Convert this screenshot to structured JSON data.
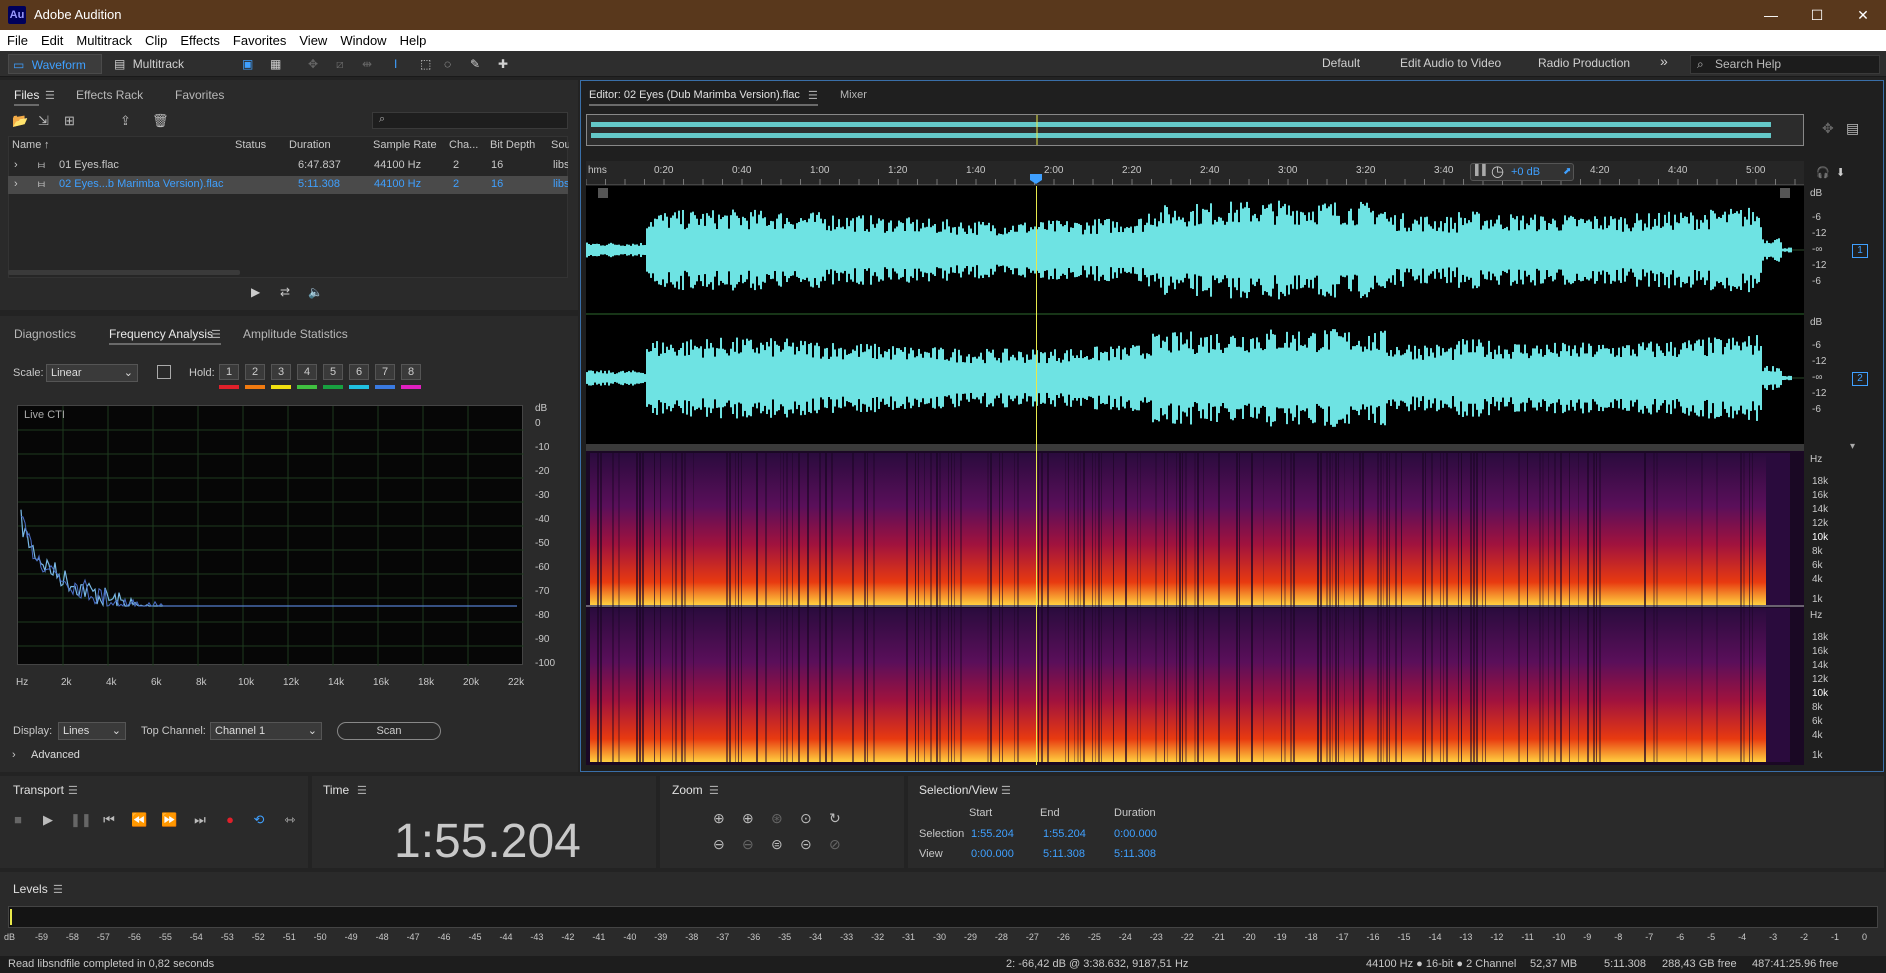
{
  "app": {
    "logo": "Au",
    "title": "Adobe Audition",
    "min": "—",
    "max": "☐",
    "close": "✕"
  },
  "menu": [
    "File",
    "Edit",
    "Multitrack",
    "Clip",
    "Effects",
    "Favorites",
    "View",
    "Window",
    "Help"
  ],
  "toolbar": {
    "waveform": "Waveform",
    "multitrack": "Multitrack",
    "workspaces": [
      "Default",
      "Edit Audio to Video",
      "Radio Production"
    ],
    "more": "»",
    "search_placeholder": "Search Help"
  },
  "files_panel": {
    "tabs": [
      "Files",
      "Effects Rack",
      "Favorites"
    ],
    "columns": [
      "Name",
      "Status",
      "Duration",
      "Sample Rate",
      "Cha...",
      "Bit Depth",
      "Sou"
    ],
    "rows": [
      {
        "name": "01 Eyes.flac",
        "status": "",
        "duration": "6:47.837",
        "rate": "44100 Hz",
        "channels": "2",
        "bits": "16",
        "source": "libs"
      },
      {
        "name": "02 Eyes...b Marimba Version).flac",
        "status": "",
        "duration": "5:11.308",
        "rate": "44100 Hz",
        "channels": "2",
        "bits": "16",
        "source": "libs"
      }
    ]
  },
  "analysis": {
    "tabs": [
      "Diagnostics",
      "Frequency Analysis",
      "Amplitude Statistics"
    ],
    "scale_label": "Scale:",
    "scale_value": "Linear",
    "hold_label": "Hold:",
    "holds": [
      "1",
      "2",
      "3",
      "4",
      "5",
      "6",
      "7",
      "8"
    ],
    "hold_colors": [
      "#e0202a",
      "#f07a10",
      "#f0e010",
      "#40c040",
      "#18a040",
      "#20c0e0",
      "#3a7ae0",
      "#e020c0"
    ],
    "graph_label": "Live CTI",
    "db_unit": "dB",
    "db_ticks": [
      "0",
      "-10",
      "-20",
      "-30",
      "-40",
      "-50",
      "-60",
      "-70",
      "-80",
      "-90",
      "-100"
    ],
    "hz_ticks": [
      "Hz",
      "2k",
      "4k",
      "6k",
      "8k",
      "10k",
      "12k",
      "14k",
      "16k",
      "18k",
      "20k",
      "22k"
    ],
    "display_label": "Display:",
    "display_value": "Lines",
    "top_channel_label": "Top Channel:",
    "top_channel_value": "Channel 1",
    "scan": "Scan",
    "advanced": "Advanced"
  },
  "editor": {
    "tab": "Editor: 02 Eyes (Dub Marimba Version).flac",
    "mixer": "Mixer",
    "ruler": [
      "hms",
      "0:20",
      "0:40",
      "1:00",
      "1:20",
      "1:40",
      "2:00",
      "2:20",
      "2:40",
      "3:00",
      "3:20",
      "3:40",
      "4:20",
      "4:40",
      "5:00"
    ],
    "hud_db": "+0 dB",
    "ch1_db": [
      "dB",
      "-6",
      "-12",
      "-∞",
      "-12",
      "-6"
    ],
    "ch2_db": [
      "dB",
      "-6",
      "-12",
      "-∞",
      "-12",
      "-6"
    ],
    "ch1": "1",
    "ch2": "2",
    "hz_ticks": [
      "Hz",
      "18k",
      "16k",
      "14k",
      "12k",
      "10k",
      "8k",
      "6k",
      "4k",
      "1k"
    ]
  },
  "transport": {
    "title": "Transport"
  },
  "time": {
    "title": "Time",
    "value": "1:55.204"
  },
  "zoom": {
    "title": "Zoom"
  },
  "selection": {
    "title": "Selection/View",
    "headers": [
      "Start",
      "End",
      "Duration"
    ],
    "rows": [
      {
        "label": "Selection",
        "start": "1:55.204",
        "end": "1:55.204",
        "duration": "0:00.000"
      },
      {
        "label": "View",
        "start": "0:00.000",
        "end": "5:11.308",
        "duration": "5:11.308"
      }
    ]
  },
  "levels": {
    "title": "Levels",
    "ticks": [
      "dB",
      "-59",
      "-58",
      "-57",
      "-56",
      "-55",
      "-54",
      "-53",
      "-52",
      "-51",
      "-50",
      "-49",
      "-48",
      "-47",
      "-46",
      "-45",
      "-44",
      "-43",
      "-42",
      "-41",
      "-40",
      "-39",
      "-38",
      "-37",
      "-36",
      "-35",
      "-34",
      "-33",
      "-32",
      "-31",
      "-30",
      "-29",
      "-28",
      "-27",
      "-26",
      "-25",
      "-24",
      "-23",
      "-22",
      "-21",
      "-20",
      "-19",
      "-18",
      "-17",
      "-16",
      "-15",
      "-14",
      "-13",
      "-12",
      "-11",
      "-10",
      "-9",
      "-8",
      "-7",
      "-6",
      "-5",
      "-4",
      "-3",
      "-2",
      "-1",
      "0"
    ]
  },
  "status": {
    "left": "Read libsndfile completed in 0,82 seconds",
    "cursor": "2: -66,42 dB @ 3:38.632, 9187,51 Hz",
    "format": "44100 Hz ● 16-bit ● 2 Channel",
    "size": "52,37 MB",
    "duration": "5:11.308",
    "free": "288,43 GB free",
    "free_time": "487:41:25.96 free"
  },
  "colors": {
    "waveform": "#6ee3e3",
    "accent": "#3fa0ff",
    "playhead": "#e8e84a"
  }
}
